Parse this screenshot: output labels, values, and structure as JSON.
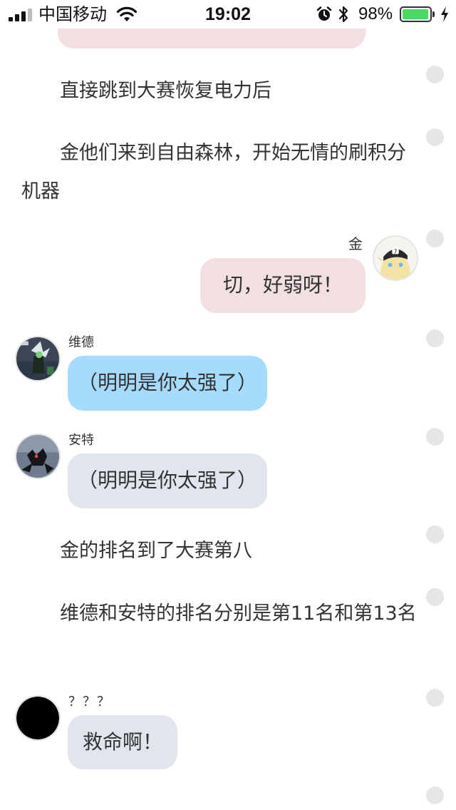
{
  "status_bar": {
    "carrier": "中国移动",
    "time": "19:02",
    "battery_percent": "98%",
    "battery_level": 0.98,
    "icons": [
      "signal-icon",
      "wifi-icon",
      "alarm-icon",
      "bluetooth-icon",
      "battery-icon",
      "charging-icon"
    ]
  },
  "colors": {
    "pink_bubble": "#f2dfe1",
    "blue_bubble": "#a6dbfd",
    "gray_bubble": "#e1e6ee",
    "battery_green": "#4cd964"
  },
  "messages": [
    {
      "type": "narration",
      "text": "直接跳到大赛恢复电力后"
    },
    {
      "type": "narration",
      "text": "金他们来到自由森林，开始无情的刷积分机器"
    },
    {
      "type": "bubble",
      "sender": "金",
      "text": "切，好弱呀！"
    },
    {
      "type": "bubble",
      "sender": "维德",
      "text": "（明明是你太强了）"
    },
    {
      "type": "bubble",
      "sender": "安特",
      "text": "（明明是你太强了）"
    },
    {
      "type": "narration",
      "text": "金的排名到了大赛第八"
    },
    {
      "type": "narration",
      "text": "维德和安特的排名分别是第11名和第13名"
    },
    {
      "type": "bubble",
      "sender": "？？？",
      "text": "救命啊！"
    }
  ]
}
